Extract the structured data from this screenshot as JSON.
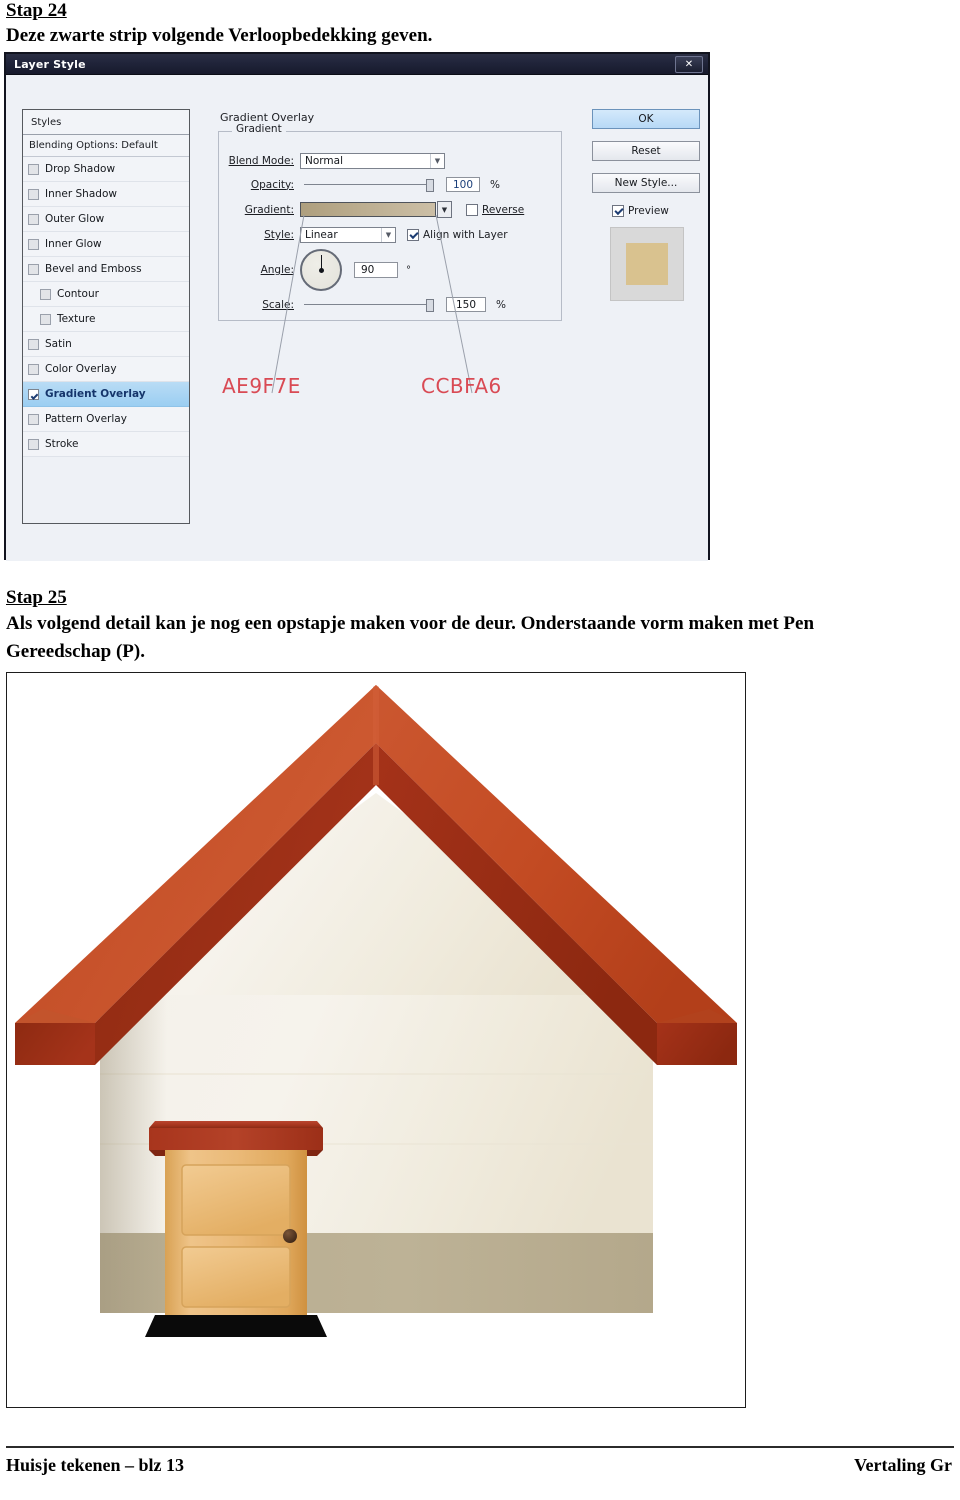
{
  "document": {
    "footer_left": "Huisje tekenen – blz 13",
    "footer_right": "Vertaling Gr"
  },
  "stap24": {
    "heading": "Stap 24",
    "text": "Deze zwarte strip volgende Verloopbedekking geven."
  },
  "stap25": {
    "heading": "Stap 25",
    "line1": "Als volgend detail kan je nog een opstapje maken voor de deur. Onderstaande vorm maken met Pen",
    "line2": "Gereedschap (P)."
  },
  "dialog": {
    "title": "Layer Style",
    "close_label": "✕",
    "styles_label": "Styles",
    "blending_label": "Blending Options: Default",
    "effects": [
      {
        "label": "Drop Shadow",
        "checked": false,
        "indent": false,
        "active": false
      },
      {
        "label": "Inner Shadow",
        "checked": false,
        "indent": false,
        "active": false
      },
      {
        "label": "Outer Glow",
        "checked": false,
        "indent": false,
        "active": false
      },
      {
        "label": "Inner Glow",
        "checked": false,
        "indent": false,
        "active": false
      },
      {
        "label": "Bevel and Emboss",
        "checked": false,
        "indent": false,
        "active": false
      },
      {
        "label": "Contour",
        "checked": false,
        "indent": true,
        "active": false
      },
      {
        "label": "Texture",
        "checked": false,
        "indent": true,
        "active": false
      },
      {
        "label": "Satin",
        "checked": false,
        "indent": false,
        "active": false
      },
      {
        "label": "Color Overlay",
        "checked": false,
        "indent": false,
        "active": false
      },
      {
        "label": "Gradient Overlay",
        "checked": true,
        "indent": false,
        "active": true
      },
      {
        "label": "Pattern Overlay",
        "checked": false,
        "indent": false,
        "active": false
      },
      {
        "label": "Stroke",
        "checked": false,
        "indent": false,
        "active": false
      }
    ],
    "panel": {
      "title": "Gradient Overlay",
      "group_legend": "Gradient",
      "blend_mode_label": "Blend Mode:",
      "blend_mode_value": "Normal",
      "opacity_label": "Opacity:",
      "opacity_value": "100",
      "opacity_unit": "%",
      "gradient_label": "Gradient:",
      "reverse_label": "Reverse",
      "reverse_checked": false,
      "style_label": "Style:",
      "style_value": "Linear",
      "align_label": "Align with Layer",
      "align_checked": true,
      "angle_label": "Angle:",
      "angle_value": "90",
      "angle_unit": "°",
      "scale_label": "Scale:",
      "scale_value": "150",
      "scale_unit": "%"
    },
    "buttons": {
      "ok": "OK",
      "reset": "Reset",
      "new_style": "New Style...",
      "preview_label": "Preview",
      "preview_checked": true
    },
    "annotations": {
      "hex_left": "AE9F7E",
      "hex_right": "CCBFA6"
    },
    "colors": {
      "gradient_start": "#AE9F7E",
      "gradient_end": "#CCBFA6",
      "titlebar": "#20243a",
      "highlight": "#9bcef2",
      "annotation_text": "#d94a54",
      "preview_fill": "#d9c28f"
    }
  },
  "illustration": {
    "name": "house-with-door-and-step",
    "colors": {
      "roof_light": "#c8502a",
      "roof_mid": "#c0471f",
      "roof_dark": "#a32f14",
      "roof_edge": "#8e2710",
      "wall_light": "#f3efe6",
      "wall_mid": "#efe9da",
      "wall_base": "#b9ae92",
      "door_light": "#f0c88c",
      "door_mid": "#e0a95d",
      "door_dark": "#d49a4b",
      "door_top_light": "#b8422c",
      "door_top_dark": "#8f2d18",
      "knob": "#4a2f1e",
      "step": "#0b0b0b"
    }
  }
}
